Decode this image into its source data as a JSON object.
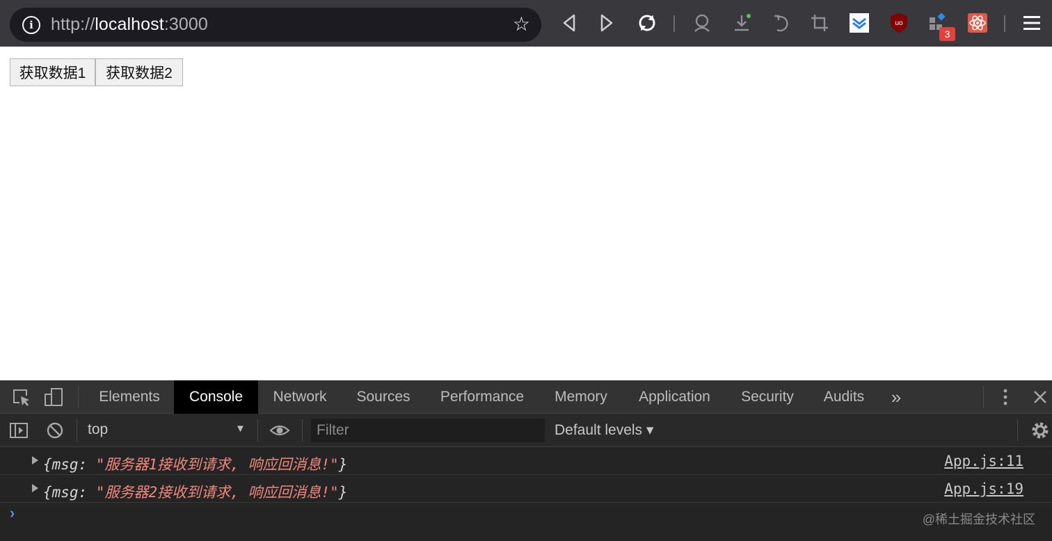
{
  "browser": {
    "url_scheme": "http://",
    "url_host": "localhost",
    "url_port": ":3000",
    "extension_badge_count": "3"
  },
  "page": {
    "button1_label": "获取数据1",
    "button2_label": "获取数据2"
  },
  "devtools": {
    "tabs": [
      "Elements",
      "Console",
      "Network",
      "Sources",
      "Performance",
      "Memory",
      "Application",
      "Security",
      "Audits"
    ],
    "active_tab": "Console",
    "more_tabs_label": "»",
    "context_selector": "top",
    "filter_placeholder": "Filter",
    "levels_label": "Default levels ▾",
    "logs": [
      {
        "prefix": "{msg: ",
        "value": "\"服务器1接收到请求, 响应回消息!\"",
        "suffix": "}",
        "source": "App.js:11"
      },
      {
        "prefix": "{msg: ",
        "value": "\"服务器2接收到请求, 响应回消息!\"",
        "suffix": "}",
        "source": "App.js:19"
      }
    ],
    "prompt_symbol": "›",
    "watermark": "@稀土掘金技术社区"
  },
  "colors": {
    "toolbar_bg": "#38383d",
    "urlbar_bg": "#1c1b22",
    "devtools_bg": "#242424",
    "console_string": "#f2877d",
    "prompt_blue": "#4d8ef8"
  }
}
